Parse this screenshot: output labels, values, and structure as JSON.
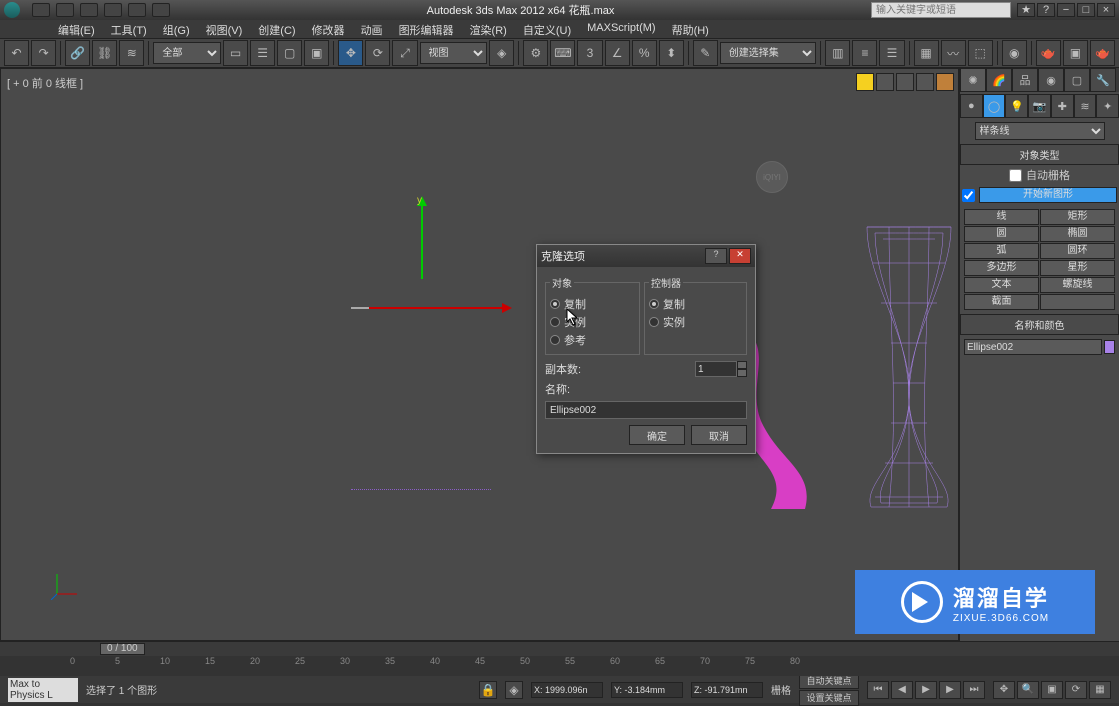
{
  "title": "Autodesk 3ds Max  2012 x64      花瓶.max",
  "search_placeholder": "输入关键字或短语",
  "menu": [
    "编辑(E)",
    "工具(T)",
    "组(G)",
    "视图(V)",
    "创建(C)",
    "修改器",
    "动画",
    "图形编辑器",
    "渲染(R)",
    "自定义(U)",
    "MAXScript(M)",
    "帮助(H)"
  ],
  "toolbar": {
    "selset_label": "全部",
    "view_label": "视图",
    "create_sel": "创建选择集"
  },
  "viewport": {
    "label": "[ + 0 前 0 线框 ]",
    "gizmo_y": "y"
  },
  "cmd": {
    "cat_label": "样条线",
    "rollout_type": "对象类型",
    "auto_grid": "自动栅格",
    "start_shape": "开始新图形",
    "types": [
      [
        "线",
        "矩形"
      ],
      [
        "圆",
        "椭圆"
      ],
      [
        "弧",
        "圆环"
      ],
      [
        "多边形",
        "星形"
      ],
      [
        "文本",
        "螺旋线"
      ],
      [
        "截面",
        ""
      ]
    ],
    "rollout_name": "名称和颜色",
    "name_value": "Ellipse002"
  },
  "dialog": {
    "title": "克隆选项",
    "grp_obj": "对象",
    "grp_ctrl": "控制器",
    "opt_copy": "复制",
    "opt_inst": "实例",
    "opt_ref": "参考",
    "copies_lbl": "副本数:",
    "copies_val": "1",
    "name_lbl": "名称:",
    "name_val": "Ellipse002",
    "ok": "确定",
    "cancel": "取消"
  },
  "timeline": {
    "pos": "0 / 100",
    "ticks": [
      "0",
      "5",
      "10",
      "15",
      "20",
      "25",
      "30",
      "35",
      "40",
      "45",
      "50",
      "55",
      "60",
      "65",
      "70",
      "75",
      "80"
    ]
  },
  "status": {
    "prompt": "选择了 1 个图形",
    "x": "X: 1999.096n",
    "y": "Y: -3.184mm",
    "z": "Z: -91.791mn",
    "grid": "栅格",
    "autokey": "自动关键点",
    "setkey": "设置关键点",
    "script": "Max to Physics L"
  },
  "watermark": {
    "main": "溜溜自学",
    "sub": "ZIXUE.3D66.COM"
  }
}
